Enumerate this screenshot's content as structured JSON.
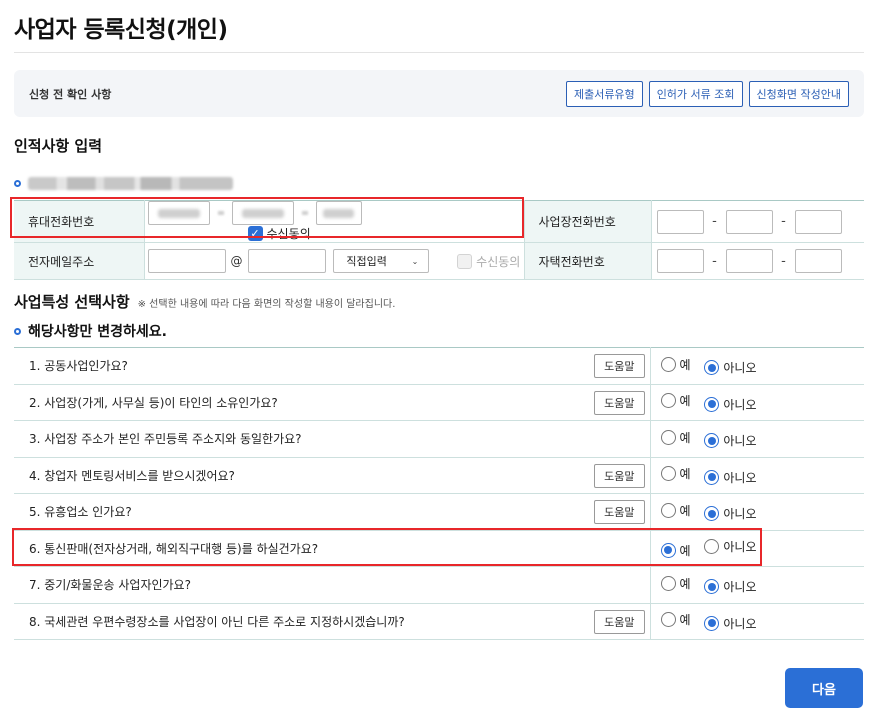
{
  "page_title": "사업자 등록신청(개인)",
  "precheck": {
    "label": "신청 전 확인 사항",
    "buttons": [
      "제출서류유형",
      "인허가 서류 조회",
      "신청화면 작성안내"
    ]
  },
  "personal_info": {
    "title": "인적사항 입력",
    "rows": {
      "mobile_label": "휴대전화번호",
      "mobile_consent": "수신동의",
      "biz_phone_label": "사업장전화번호",
      "email_label": "전자메일주소",
      "email_at": "@",
      "email_domain_select": "직접입력",
      "email_consent": "수신동의",
      "home_phone_label": "자택전화번호",
      "dash": "-"
    }
  },
  "business_features": {
    "title": "사업특성 선택사항",
    "note": "※ 선택한 내용에 따라 다음 화면의 작성할 내용이 달라집니다.",
    "subtitle": "해당사항만 변경하세요.",
    "help_label": "도움말",
    "yes_label": "예",
    "no_label": "아니오",
    "questions": [
      {
        "text": "1. 공동사업인가요?",
        "help": true,
        "answer": "no"
      },
      {
        "text": "2. 사업장(가게, 사무실 등)이 타인의 소유인가요?",
        "help": true,
        "answer": "no"
      },
      {
        "text": "3. 사업장 주소가 본인 주민등록 주소지와 동일한가요?",
        "help": false,
        "answer": "no"
      },
      {
        "text": "4. 창업자 멘토링서비스를 받으시겠어요?",
        "help": true,
        "answer": "no"
      },
      {
        "text": "5. 유흥업소 인가요?",
        "help": true,
        "answer": "no"
      },
      {
        "text": "6. 통신판매(전자상거래, 해외직구대행 등)를 하실건가요?",
        "help": false,
        "answer": "yes"
      },
      {
        "text": "7. 중기/화물운송 사업자인가요?",
        "help": false,
        "answer": "no"
      },
      {
        "text": "8. 국세관련 우편수령장소를 사업장이 아닌 다른 주소로 지정하시겠습니까?",
        "help": true,
        "answer": "no"
      }
    ]
  },
  "next_button": "다음",
  "colors": {
    "accent": "#2b6fd6",
    "highlight": "#e8272a",
    "table_header_bg": "#eef6f5"
  }
}
